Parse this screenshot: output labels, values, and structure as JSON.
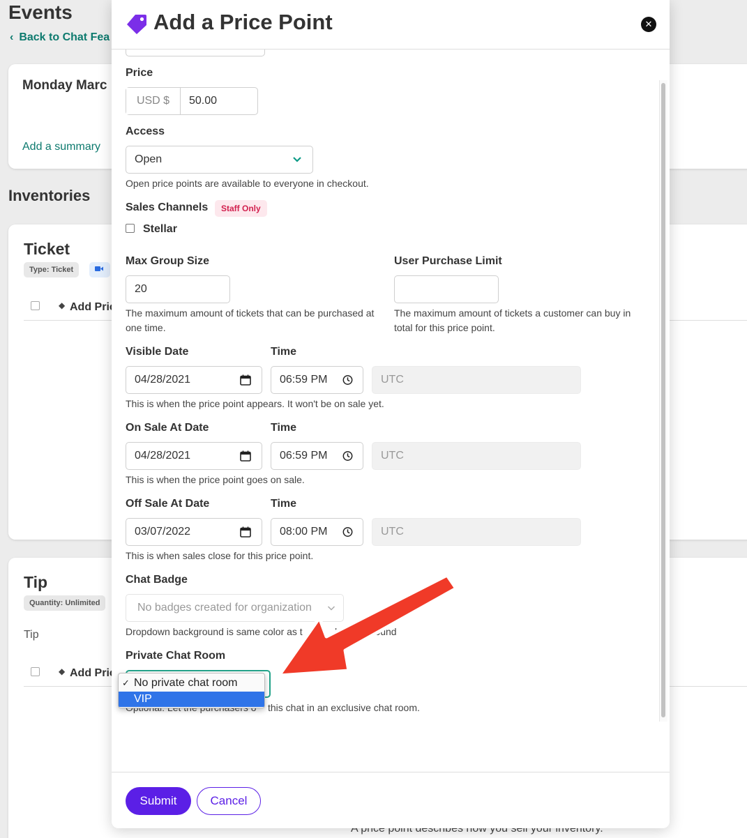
{
  "background": {
    "page_title": "Events",
    "back_link": "Back to Chat Fea",
    "event_date": "Monday Marc",
    "add_summary": "Add a summary",
    "inventories_heading": "Inventories",
    "ticket": {
      "title": "Ticket",
      "type_badge": "Type: Ticket",
      "add_price_point": "Add Price P"
    },
    "tip": {
      "title": "Tip",
      "quantity_badge": "Quantity: Unlimited",
      "subtitle": "Tip",
      "add_price_point": "Add Price P"
    },
    "footer_text": "A price point describes how you sell your inventory."
  },
  "modal": {
    "title": "Add a Price Point",
    "price": {
      "label": "Price",
      "currency": "USD $",
      "value": "50.00"
    },
    "access": {
      "label": "Access",
      "value": "Open",
      "help": "Open price points are available to everyone in checkout."
    },
    "sales_channels": {
      "label": "Sales Channels",
      "badge": "Staff Only",
      "option": "Stellar"
    },
    "max_group_size": {
      "label": "Max Group Size",
      "value": "20",
      "help": "The maximum amount of tickets that can be purchased at one time."
    },
    "user_purchase_limit": {
      "label": "User Purchase Limit",
      "value": "",
      "help": "The maximum amount of tickets a customer can buy in total for this price point."
    },
    "visible_date": {
      "label": "Visible Date",
      "time_label": "Time",
      "date": "04/28/2021",
      "time": "06:59 PM",
      "timezone": "UTC",
      "help": "This is when the price point appears. It won't be on sale yet."
    },
    "on_sale_date": {
      "label": "On Sale At Date",
      "time_label": "Time",
      "date": "04/28/2021",
      "time": "06:59 PM",
      "timezone": "UTC",
      "help": "This is when the price point goes on sale."
    },
    "off_sale_date": {
      "label": "Off Sale At Date",
      "time_label": "Time",
      "date": "03/07/2022",
      "time": "08:00 PM",
      "timezone": "UTC",
      "help": "This is when sales close for this price point."
    },
    "chat_badge": {
      "label": "Chat Badge",
      "placeholder": "No badges created for organization",
      "help_left": "Dropdown background is same color as t",
      "help_mid": "he cha",
      "help_right": "ground"
    },
    "private_chat_room": {
      "label": "Private Chat Room",
      "help_left": "Optional: Let the purchasers o",
      "help_right": "this chat in an exclusive chat room.",
      "options": [
        {
          "check": "✓",
          "label": "No private chat room"
        },
        {
          "check": "",
          "label": "VIP"
        }
      ]
    },
    "buttons": {
      "submit": "Submit",
      "cancel": "Cancel"
    }
  },
  "colors": {
    "accent": "#5b1fe6",
    "teal": "#0d7a6e",
    "annotation_arrow": "#f03a28",
    "selected_option": "#2f74e8"
  }
}
